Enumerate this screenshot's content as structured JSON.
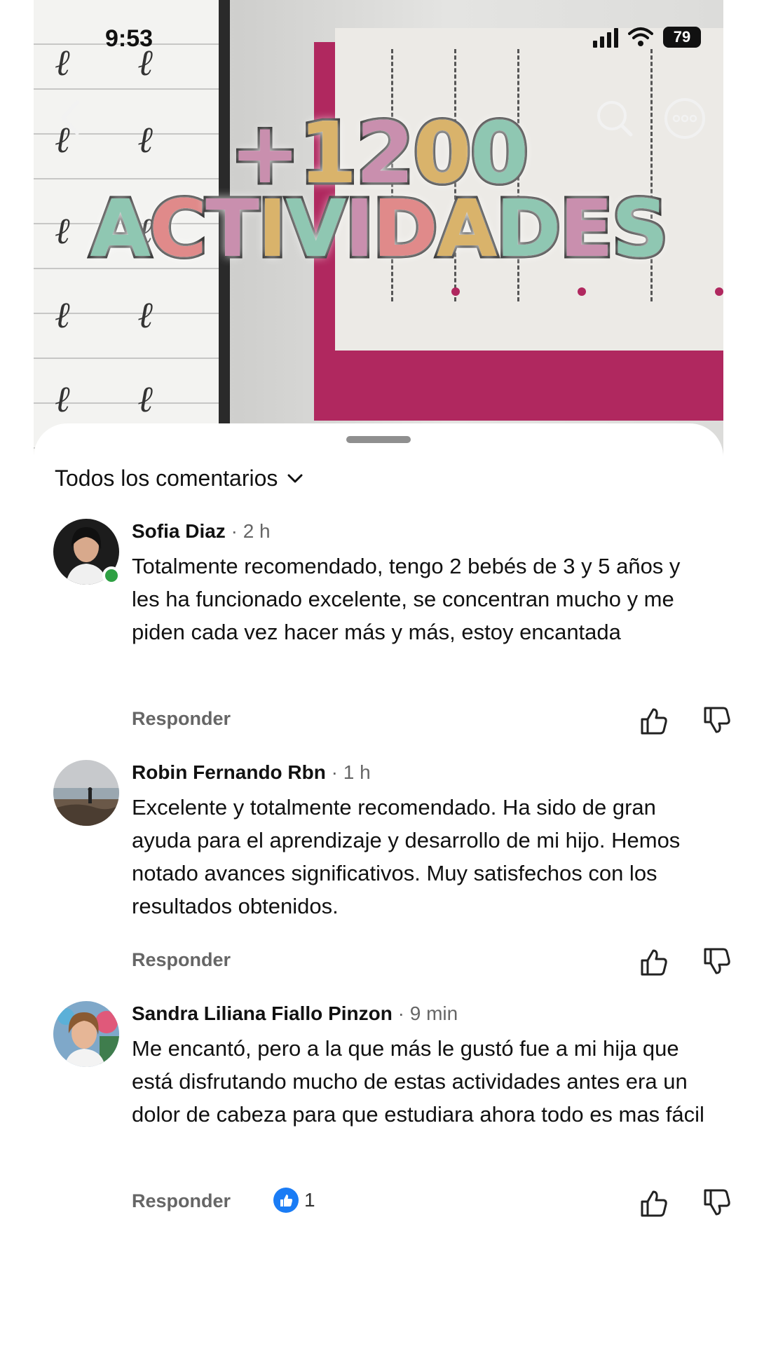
{
  "status_bar": {
    "time": "9:53",
    "battery": "79"
  },
  "video": {
    "title_line1": "+1200",
    "title_line2": "ACTIVIDADES",
    "title_line1_colors": [
      "#c98fae",
      "#d9b36b",
      "#c98fae",
      "#d9b36b",
      "#8fc7b2"
    ],
    "title_line2_colors": [
      "#8fc7b2",
      "#e08a8a",
      "#c98fae",
      "#d9b36b",
      "#8fc7b2",
      "#c98fae",
      "#e08a8a",
      "#d9b36b",
      "#8fc7b2",
      "#c98fae",
      "#8fc7b2"
    ]
  },
  "sheet": {
    "header": "Todos los comentarios"
  },
  "comments": [
    {
      "author": "Sofia Diaz",
      "time": "· 2 h",
      "text": "Totalmente recomendado, tengo 2 bebés de 3 y 5 años y les ha funcionado excelente, se concentran mucho y me piden cada vez hacer más y más, estoy encantada",
      "reply": "Responder",
      "online": true
    },
    {
      "author": "Robin Fernando Rbn",
      "time": "· 1 h",
      "text": "Excelente y totalmente recomendado. Ha sido de gran ayuda para el aprendizaje y desarrollo de mi hijo. Hemos notado avances significativos. Muy satisfechos con los resultados obtenidos.",
      "reply": "Responder"
    },
    {
      "author": "Sandra Liliana Fiallo Pinzon",
      "time": "· 9 min",
      "text": "Me encantó, pero a la que más le gustó fue a mi hija que está disfrutando mucho de estas actividades antes era un dolor de cabeza para que estudiara ahora todo es mas fácil",
      "reply": "Responder",
      "likes": "1"
    }
  ],
  "icons": {
    "back": "chevron-left-icon",
    "search": "search-icon",
    "more": "more-icon",
    "like": "thumbs-up-icon",
    "dislike": "thumbs-down-icon"
  },
  "colors": {
    "board": "#b0285f",
    "online": "#2ea043",
    "like_badge": "#1a7cf5"
  }
}
